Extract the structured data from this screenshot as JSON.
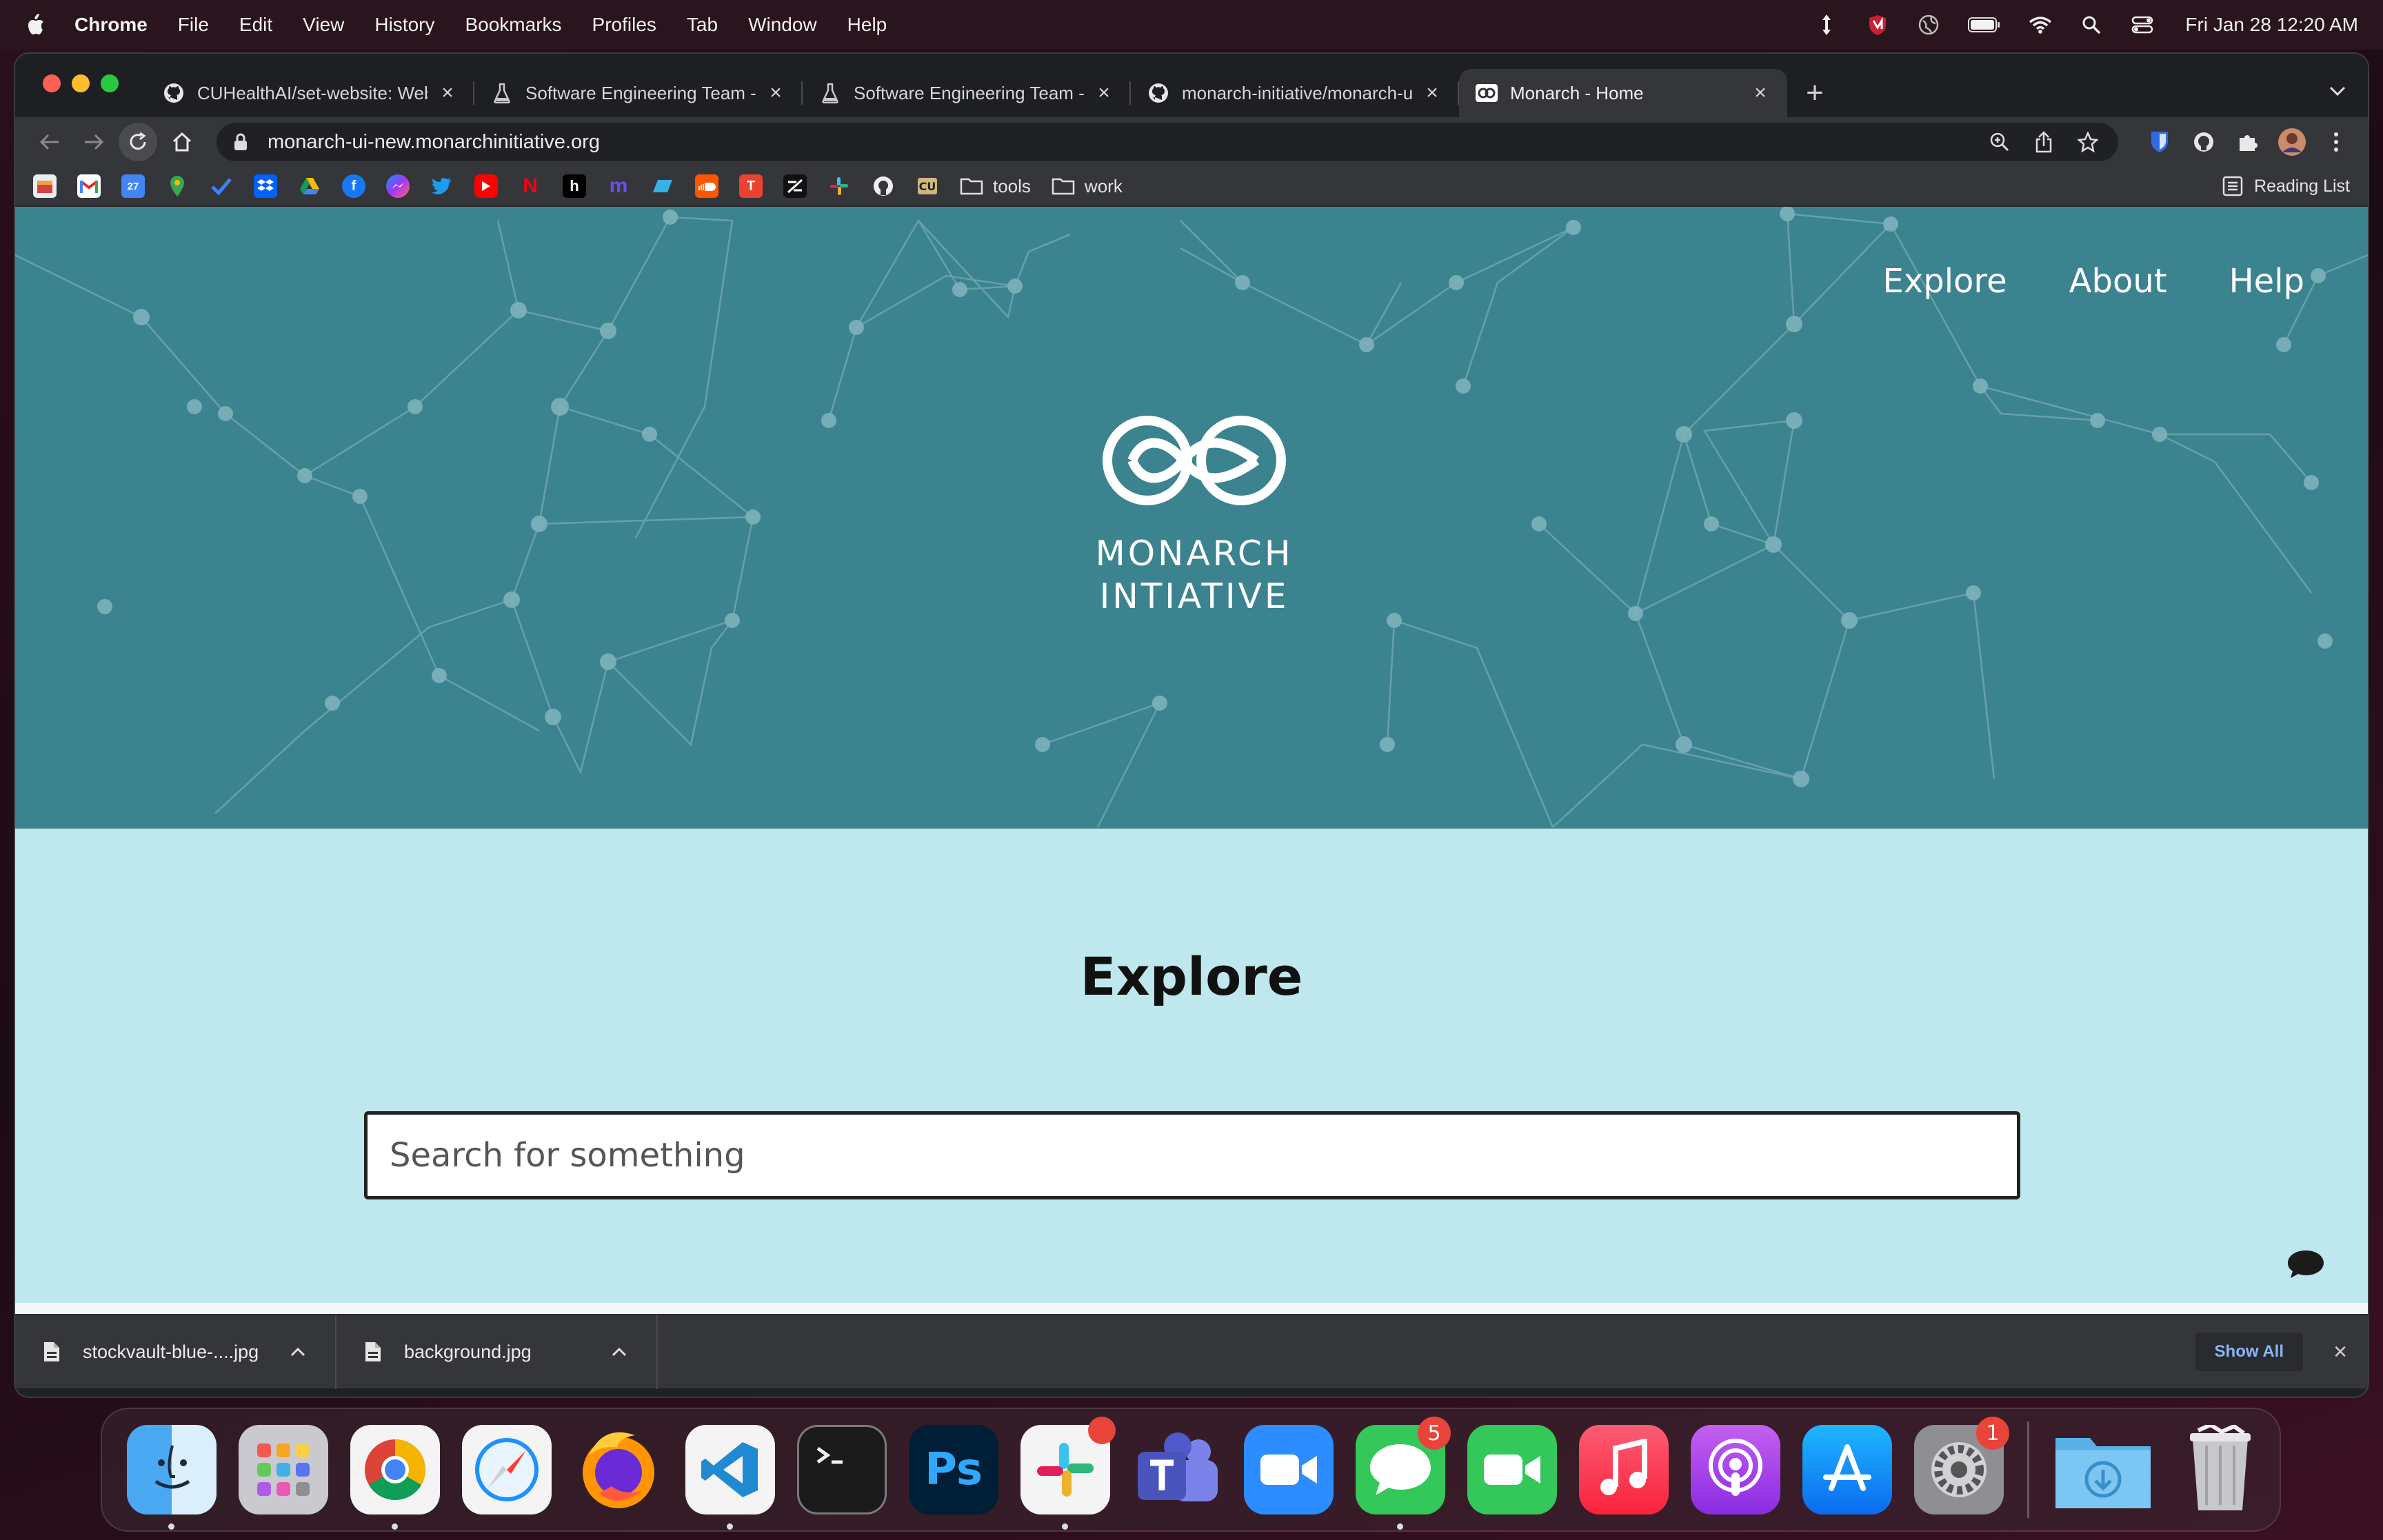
{
  "menubar": {
    "app_name": "Chrome",
    "menus": [
      "File",
      "Edit",
      "View",
      "History",
      "Bookmarks",
      "Profiles",
      "Tab",
      "Window",
      "Help"
    ],
    "clock": "Fri Jan 28  12:20 AM"
  },
  "tabs": [
    {
      "title": "CUHealthAI/set-website: Webs",
      "icon": "github-icon",
      "active": false
    },
    {
      "title": "Software Engineering Team - A",
      "icon": "flask-icon",
      "active": false
    },
    {
      "title": "Software Engineering Team - P",
      "icon": "flask-icon",
      "active": false
    },
    {
      "title": "monarch-initiative/monarch-ui",
      "icon": "github-icon",
      "active": false
    },
    {
      "title": "Monarch - Home",
      "icon": "monarch-icon",
      "active": true
    }
  ],
  "omnibox": {
    "url": "monarch-ui-new.monarchinitiative.org"
  },
  "bookmarks": {
    "folders": [
      "tools",
      "work"
    ],
    "reading_list": "Reading List"
  },
  "page": {
    "nav": {
      "explore": "Explore",
      "about": "About",
      "help": "Help"
    },
    "logo": {
      "line1": "MONARCH",
      "line2": "INTIATIVE"
    },
    "explore_heading": "Explore",
    "search": {
      "placeholder": "Search for something",
      "value": ""
    }
  },
  "downloads": {
    "items": [
      {
        "name": "stockvault-blue-....jpg"
      },
      {
        "name": "background.jpg"
      }
    ],
    "show_all": "Show All"
  },
  "dock": {
    "badges": {
      "slack": "",
      "messages": "5",
      "system_preferences": "1"
    }
  },
  "colors": {
    "hero_bg": "#3c8390",
    "explore_bg": "#bee7ee",
    "chrome_toolbar": "#35363a"
  }
}
